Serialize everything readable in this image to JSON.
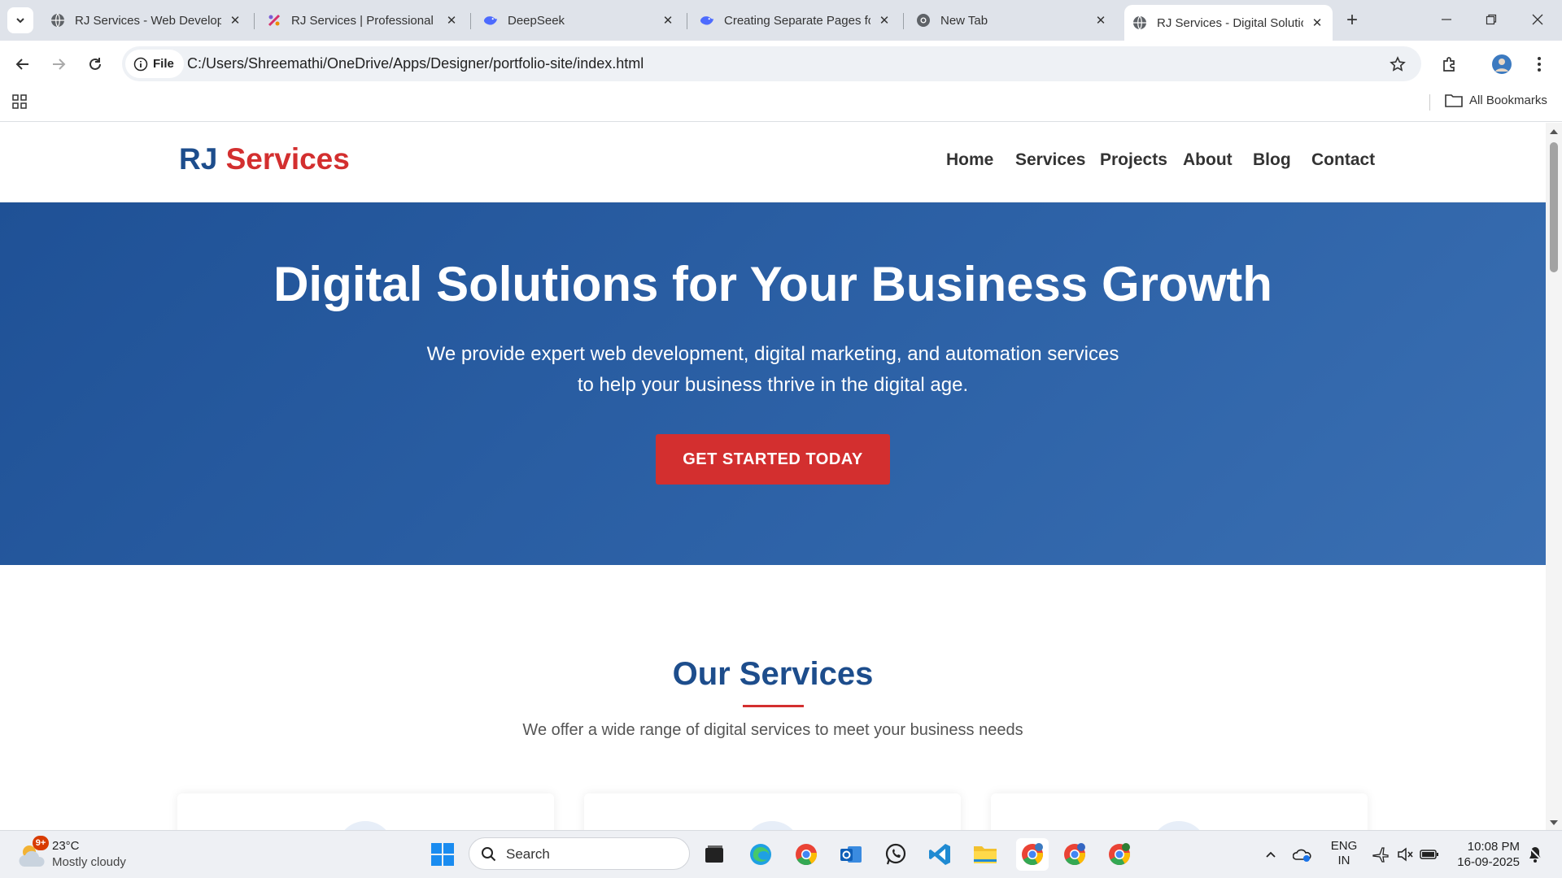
{
  "browser": {
    "tabs": [
      {
        "title": "RJ Services - Web Develop",
        "favicon": "globe-icon",
        "active": false
      },
      {
        "title": "RJ Services | Professional P",
        "favicon": "designer-icon",
        "active": false
      },
      {
        "title": "DeepSeek",
        "favicon": "deepseek-icon",
        "active": false
      },
      {
        "title": "Creating Separate Pages fo",
        "favicon": "deepseek-icon",
        "active": false
      },
      {
        "title": "New Tab",
        "favicon": "chrome-icon",
        "active": false
      },
      {
        "title": "RJ Services - Digital Solutio",
        "favicon": "globe-icon",
        "active": true
      }
    ],
    "new_tab_label": "+",
    "address": {
      "chip": "File",
      "url": "C:/Users/Shreemathi/OneDrive/Apps/Designer/portfolio-site/index.html"
    },
    "bookmarks_label": "All Bookmarks"
  },
  "site": {
    "logo": {
      "part1": "RJ",
      "part2": "Services"
    },
    "nav": [
      "Home",
      "Services",
      "Projects",
      "About",
      "Blog",
      "Contact"
    ],
    "hero": {
      "title": "Digital Solutions for Your Business Growth",
      "line1": "We provide expert web development, digital marketing, and automation services",
      "line2": "to help your business thrive in the digital age.",
      "cta": "GET STARTED TODAY"
    },
    "services": {
      "title": "Our Services",
      "subtitle": "We offer a wide range of digital services to meet your business needs"
    },
    "colors": {
      "primary": "#1d4d8c",
      "accent": "#d32f2f"
    }
  },
  "taskbar": {
    "weather": {
      "badge": "9+",
      "temp": "23°C",
      "desc": "Mostly cloudy"
    },
    "search": "Search",
    "lang": {
      "l1": "ENG",
      "l2": "IN"
    },
    "clock": {
      "time": "10:08 PM",
      "date": "16-09-2025"
    }
  }
}
